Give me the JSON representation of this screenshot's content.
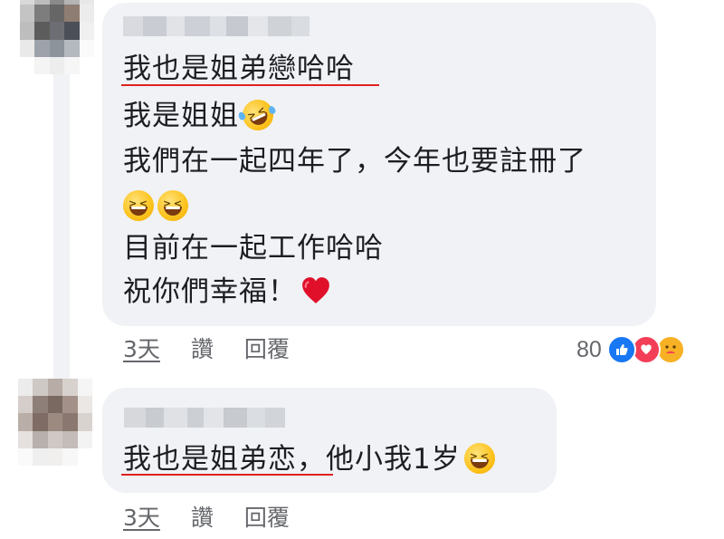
{
  "comments": [
    {
      "lines": [
        "我也是姐弟戀哈哈",
        "我是姐姐",
        "我們在一起四年了，今年也要註冊了",
        "",
        "目前在一起工作哈哈",
        "祝你們幸福！"
      ],
      "emoji": [
        "rolling-on-floor-laughing",
        "grinning-squinting-face",
        "grinning-squinting-face",
        "red-heart"
      ],
      "actions": {
        "time": "3天",
        "like": "讚",
        "reply": "回覆"
      },
      "reactions": {
        "count": "80",
        "icons": [
          "like-icon",
          "love-icon",
          "care-icon"
        ]
      }
    },
    {
      "lines": [
        "我也是姐弟恋，他小我1岁"
      ],
      "emoji": [
        "grinning-squinting-face"
      ],
      "actions": {
        "time": "3天",
        "like": "讚",
        "reply": "回覆"
      }
    }
  ],
  "colors": {
    "bubble": "#f0f2f5",
    "text": "#1c1e21",
    "meta": "#65676b",
    "underline": "#e0221f",
    "like": "#1877f2",
    "love": "#f33e58",
    "care": "#f7b125"
  }
}
